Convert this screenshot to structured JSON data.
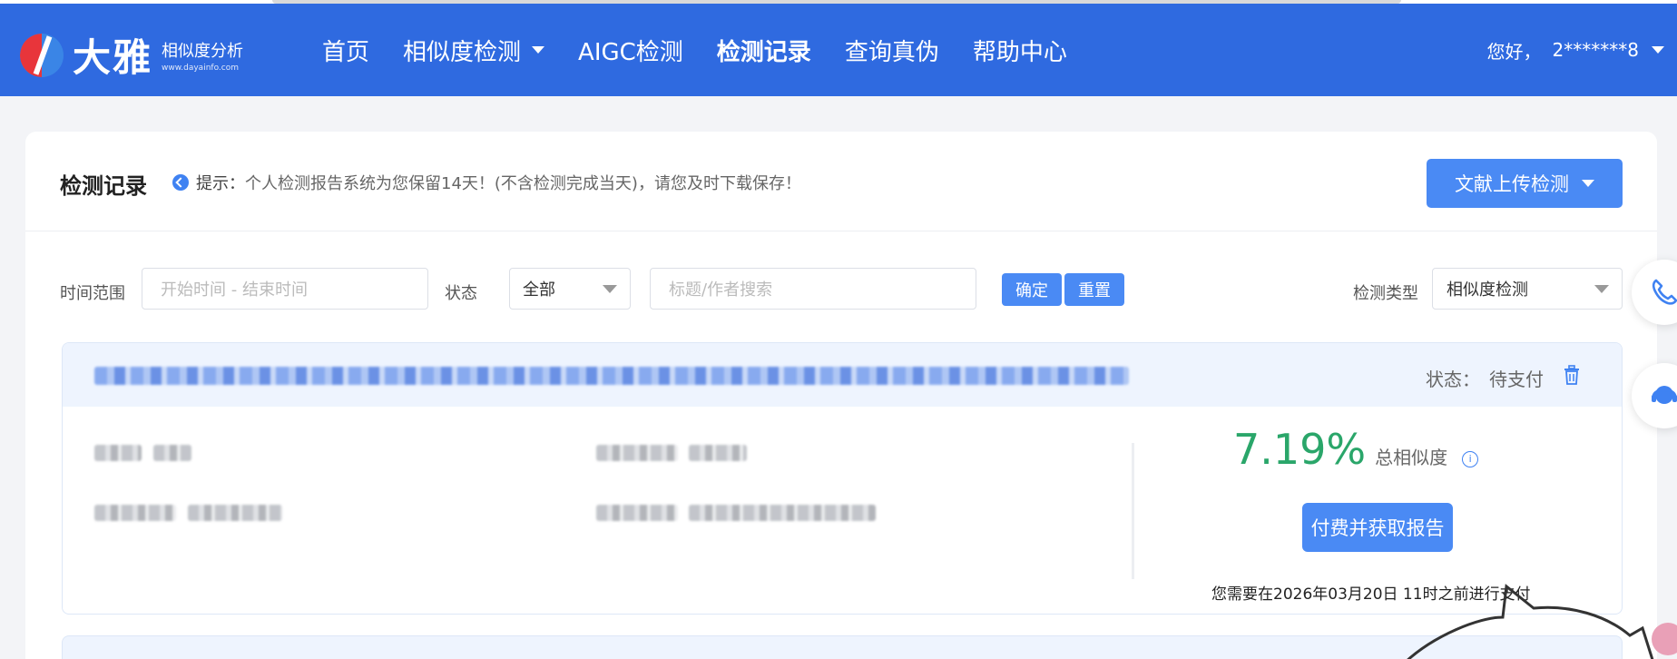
{
  "header": {
    "logo_name": "大雅",
    "logo_subtitle": "相似度分析",
    "logo_url_text": "www.dayainfo.com",
    "nav": [
      {
        "label": "首页"
      },
      {
        "label": "相似度检测"
      },
      {
        "label": "AIGC检测"
      },
      {
        "label": "检测记录"
      },
      {
        "label": "查询真伪"
      },
      {
        "label": "帮助中心"
      }
    ],
    "user_greeting": "您好，",
    "user_name": "2*******8"
  },
  "page": {
    "title": "检测记录",
    "tip_label": "提示：",
    "tip_text": "个人检测报告系统为您保留14天！(不含检测完成当天)，请您及时下载保存！",
    "upload_button": "文献上传检测"
  },
  "filters": {
    "time_label": "时间范围",
    "time_placeholder": "开始时间 - 结束时间",
    "status_label": "状态",
    "status_value": "全部",
    "search_placeholder": "标题/作者搜索",
    "confirm_button": "确定",
    "reset_button": "重置",
    "type_label": "检测类型",
    "type_value": "相似度检测"
  },
  "record": {
    "status_label": "状态：",
    "status_value": "待支付",
    "similarity_value": "7.19%",
    "similarity_label": "总相似度",
    "pay_button": "付费并获取报告",
    "deadline_text": "您需要在2026年03月20日 11时之前进行支付"
  },
  "colors": {
    "brand_blue": "#2f6ae0",
    "button_blue": "#4a8af4",
    "score_green": "#2aa66a"
  }
}
